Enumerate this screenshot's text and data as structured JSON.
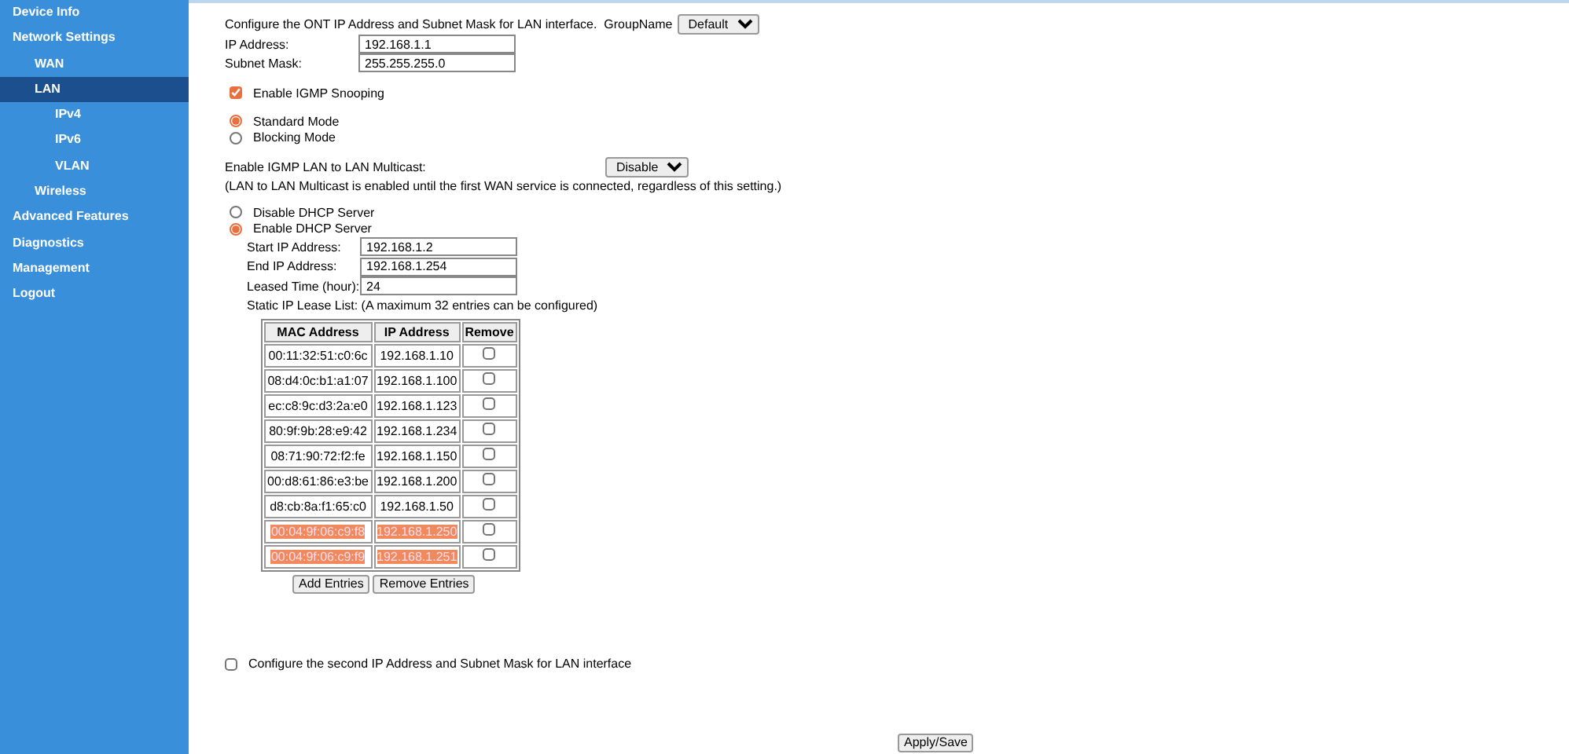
{
  "sidebar": {
    "items": [
      {
        "label": "Device Info",
        "selected": false
      },
      {
        "label": "Network Settings",
        "selected": false,
        "children": [
          {
            "label": "WAN",
            "selected": false
          },
          {
            "label": "LAN",
            "selected": true,
            "children": [
              {
                "label": "IPv4",
                "selected": false
              },
              {
                "label": "IPv6",
                "selected": false
              },
              {
                "label": "VLAN",
                "selected": false
              }
            ]
          },
          {
            "label": "Wireless",
            "selected": false
          }
        ]
      },
      {
        "label": "Advanced Features",
        "selected": false
      },
      {
        "label": "Diagnostics",
        "selected": false
      },
      {
        "label": "Management",
        "selected": false
      },
      {
        "label": "Logout",
        "selected": false
      }
    ]
  },
  "lan": {
    "intro": "Configure the ONT IP Address and Subnet Mask for LAN interface.",
    "group_name_label": "GroupName",
    "group_name": "Default",
    "fields": [
      {
        "label": "IP Address:",
        "value": "192.168.1.1"
      },
      {
        "label": "Subnet Mask:",
        "value": "255.255.255.0"
      }
    ]
  },
  "igmp_snooping": {
    "label": "Enable IGMP Snooping",
    "checked": true
  },
  "igmp_modes": [
    {
      "label": "Standard Mode",
      "selected": true
    },
    {
      "label": "Blocking Mode",
      "selected": false
    }
  ],
  "multicast": {
    "label": "Enable IGMP LAN to LAN Multicast:",
    "value": "Disable",
    "note": "(LAN to LAN Multicast is enabled until the first WAN service is connected, regardless of this setting.)"
  },
  "dhcp_modes": [
    {
      "label": "Disable DHCP Server",
      "selected": false
    },
    {
      "label": "Enable DHCP Server",
      "selected": true
    }
  ],
  "dhcp_fields": [
    {
      "label": "Start IP Address:",
      "value": "192.168.1.2"
    },
    {
      "label": "End IP Address:",
      "value": "192.168.1.254"
    },
    {
      "label": "Leased Time (hour):",
      "value": "24"
    }
  ],
  "lease_list": {
    "caption": "Static IP Lease List: (A maximum 32 entries can be configured)",
    "columns": [
      "MAC Address",
      "IP Address",
      "Remove"
    ],
    "rows": [
      {
        "mac": "00:11:32:51:c0:6c",
        "ip": "192.168.1.10",
        "remove": false,
        "highlighted": false
      },
      {
        "mac": "08:d4:0c:b1:a1:07",
        "ip": "192.168.1.100",
        "remove": false,
        "highlighted": false
      },
      {
        "mac": "ec:c8:9c:d3:2a:e0",
        "ip": "192.168.1.123",
        "remove": false,
        "highlighted": false
      },
      {
        "mac": "80:9f:9b:28:e9:42",
        "ip": "192.168.1.234",
        "remove": false,
        "highlighted": false
      },
      {
        "mac": "08:71:90:72:f2:fe",
        "ip": "192.168.1.150",
        "remove": false,
        "highlighted": false
      },
      {
        "mac": "00:d8:61:86:e3:be",
        "ip": "192.168.1.200",
        "remove": false,
        "highlighted": false
      },
      {
        "mac": "d8:cb:8a:f1:65:c0",
        "ip": "192.168.1.50",
        "remove": false,
        "highlighted": false
      },
      {
        "mac": "00:04:9f:06:c9:f8",
        "ip": "192.168.1.250",
        "remove": false,
        "highlighted": true
      },
      {
        "mac": "00:04:9f:06:c9:f9",
        "ip": "192.168.1.251",
        "remove": false,
        "highlighted": true
      }
    ],
    "buttons": [
      "Add Entries",
      "Remove Entries"
    ]
  },
  "second_ip": {
    "label": "Configure the second IP Address and Subnet Mask for LAN interface",
    "checked": false
  },
  "apply_button": "Apply/Save"
}
